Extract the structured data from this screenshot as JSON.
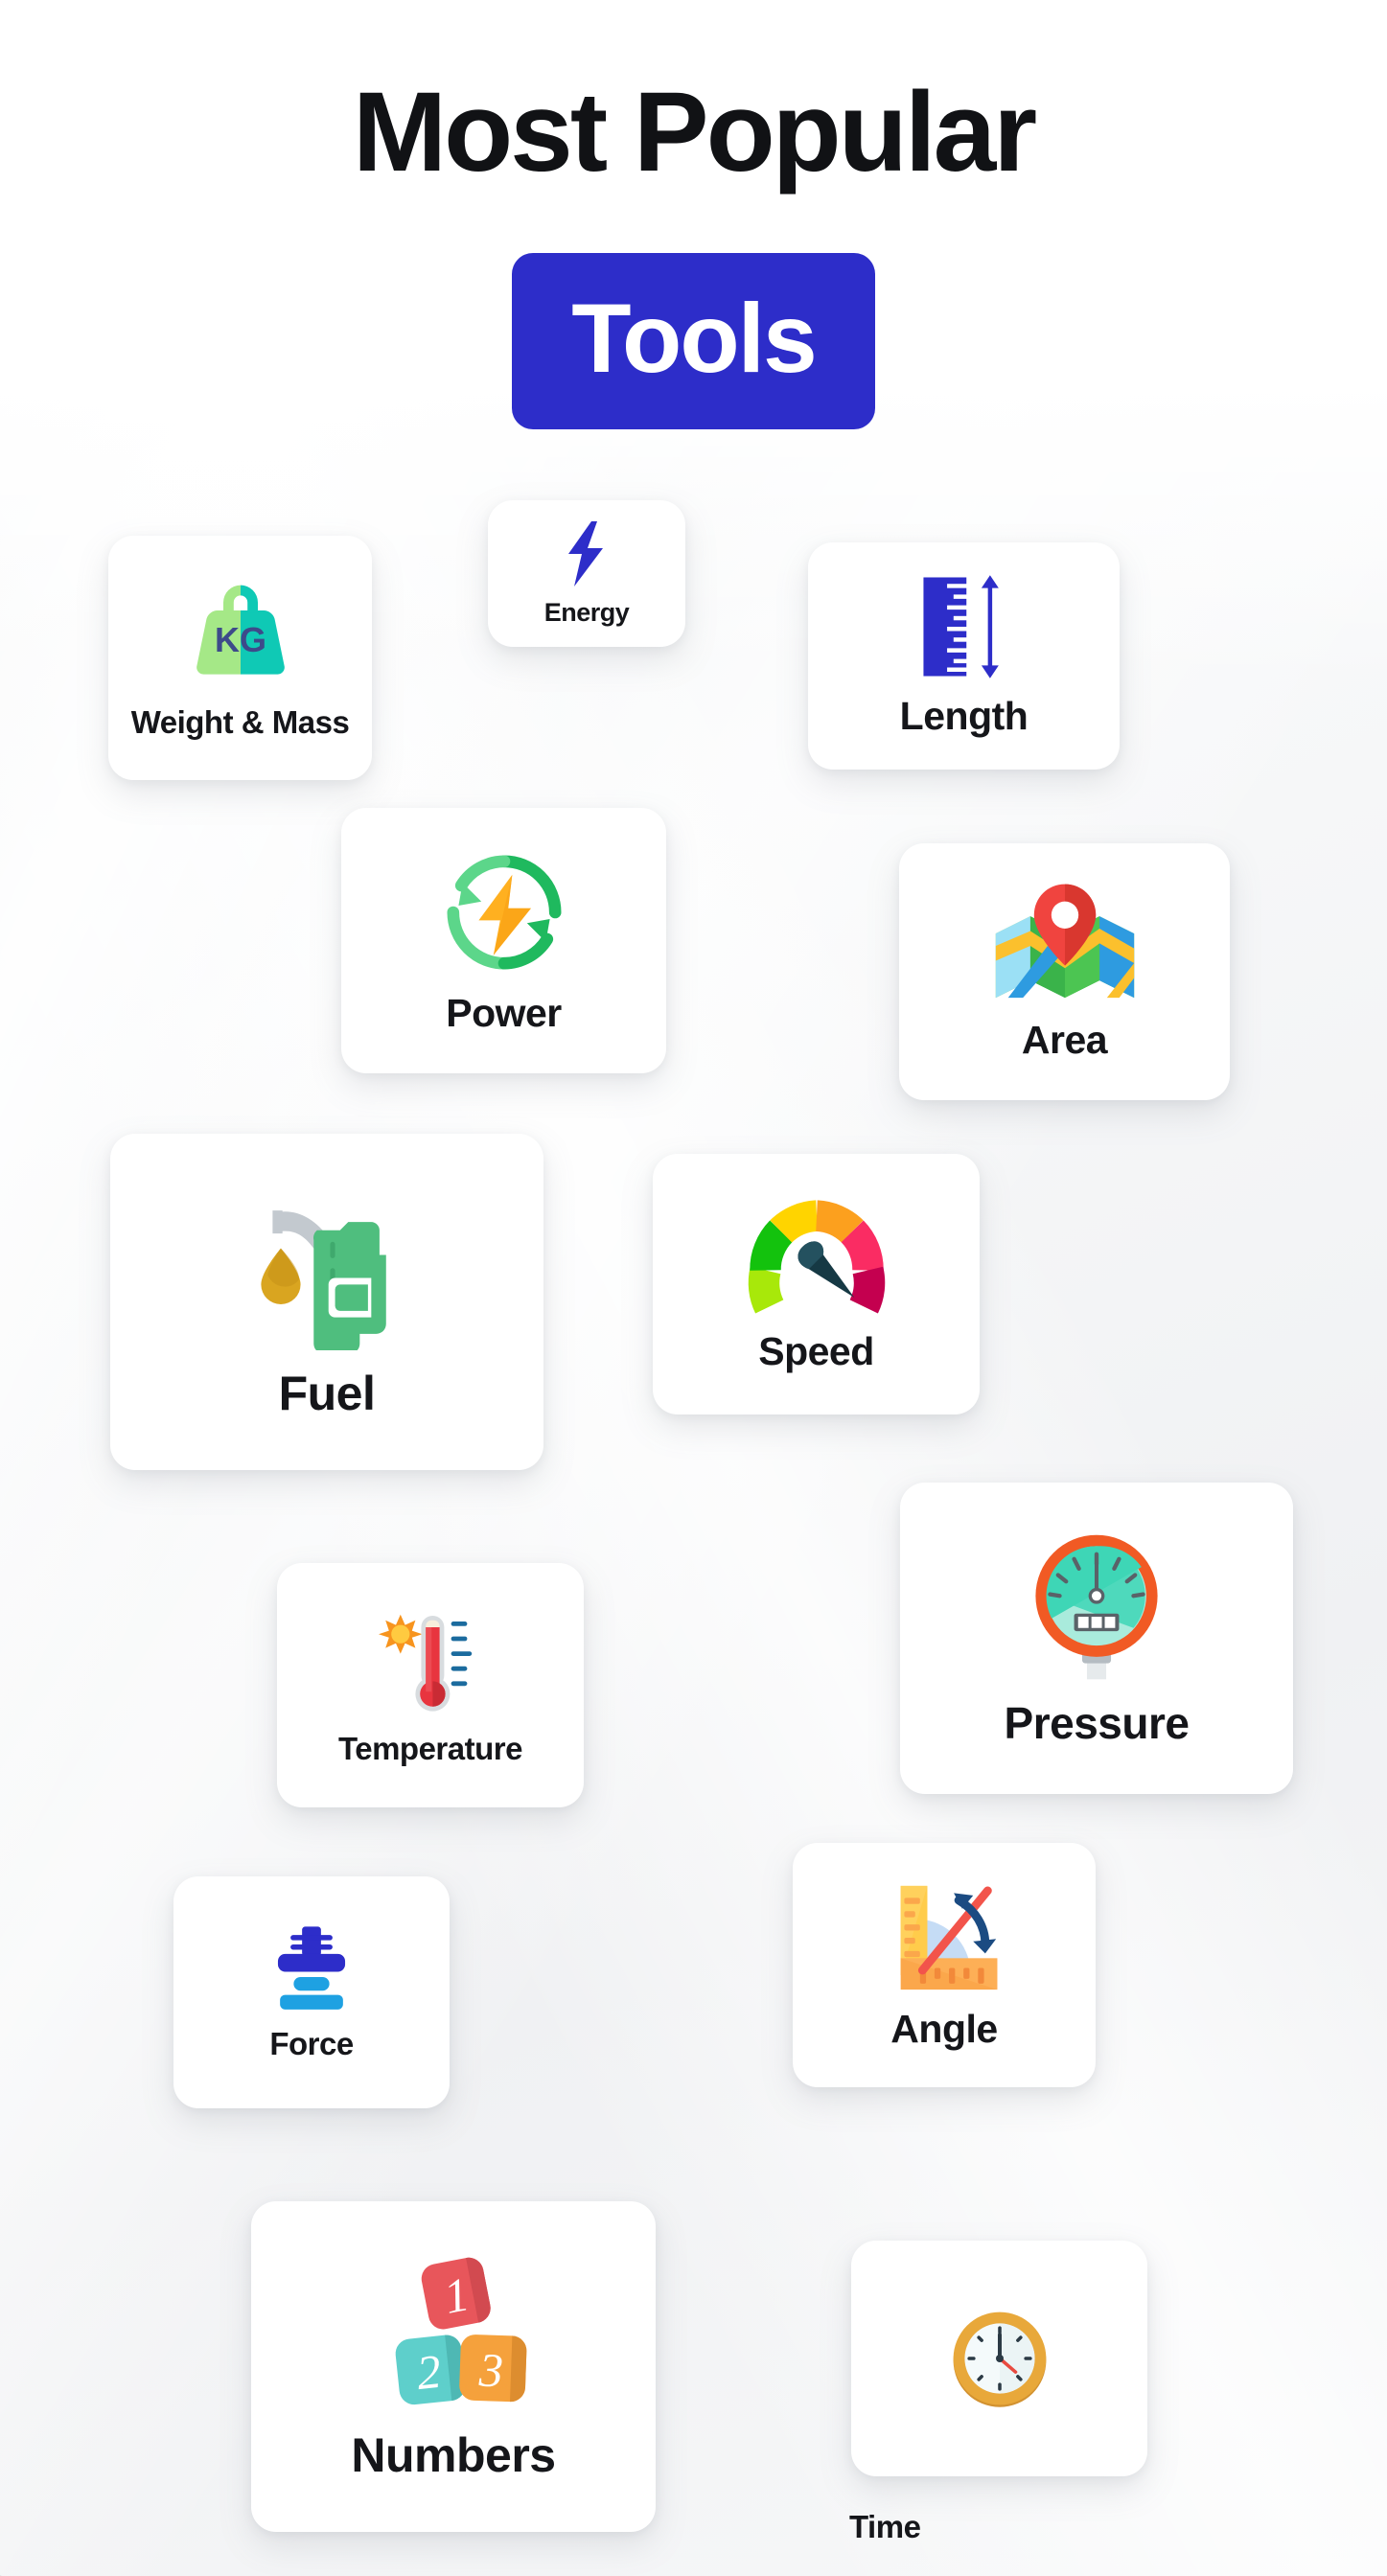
{
  "page": {
    "title_line1": "Most Popular",
    "badge_text": "Tools",
    "badge_color": "#2D2DC9",
    "background_color": "#f2f3f4",
    "card_color": "#ffffff",
    "text_color": "#15161a"
  },
  "cards": [
    {
      "id": "weight",
      "label": "Weight & Mass",
      "icon": "kg-weight-icon",
      "icon_colors": [
        "#A5E887",
        "#0FC9B5",
        "#3D4A8A"
      ]
    },
    {
      "id": "energy",
      "label": "Energy",
      "icon": "lightning-bolt-icon",
      "icon_colors": [
        "#2D2DC9"
      ]
    },
    {
      "id": "length",
      "label": "Length",
      "icon": "ruler-arrow-icon",
      "icon_colors": [
        "#2D2DC9"
      ]
    },
    {
      "id": "power",
      "label": "Power",
      "icon": "power-refresh-icon",
      "icon_colors": [
        "#3ACB6E",
        "#1FB95E",
        "#FFB020",
        "#F79E12"
      ]
    },
    {
      "id": "area",
      "label": "Area",
      "icon": "map-pin-icon",
      "icon_colors": [
        "#F0443F",
        "#4CC552",
        "#2E9BE0",
        "#FBC02D",
        "#9BE0F5"
      ]
    },
    {
      "id": "fuel",
      "label": "Fuel",
      "icon": "fuel-nozzle-icon",
      "icon_colors": [
        "#4FBE7E",
        "#C3C9CF",
        "#D9A520"
      ]
    },
    {
      "id": "speed",
      "label": "Speed",
      "icon": "speedometer-icon",
      "icon_colors": [
        "#A8E80A",
        "#13C20D",
        "#FFD400",
        "#FCA01E",
        "#FA2C63",
        "#C4004F",
        "#163944"
      ]
    },
    {
      "id": "pressure",
      "label": "Pressure",
      "icon": "pressure-gauge-icon",
      "icon_colors": [
        "#F15A24",
        "#3ED6B6",
        "#A9EBDC",
        "#5A6268"
      ]
    },
    {
      "id": "temperature",
      "label": "Temperature",
      "icon": "thermometer-icon",
      "icon_colors": [
        "#E8353F",
        "#D8DCDF",
        "#F7941E",
        "#1B6B9E"
      ]
    },
    {
      "id": "force",
      "label": "Force",
      "icon": "force-press-icon",
      "icon_colors": [
        "#2D2DC9",
        "#1EA1E2"
      ]
    },
    {
      "id": "angle",
      "label": "Angle",
      "icon": "angle-ruler-icon",
      "icon_colors": [
        "#FFD15C",
        "#FBA74B",
        "#F2544B",
        "#1B4B82",
        "#C5DCF5"
      ]
    },
    {
      "id": "numbers",
      "label": "Numbers",
      "icon": "number-blocks-icon",
      "icon_colors": [
        "#E8565B",
        "#5ECFCB",
        "#F5A13C"
      ],
      "values": [
        "1",
        "2",
        "3"
      ]
    },
    {
      "id": "time",
      "label": "Time",
      "icon": "clock-icon",
      "icon_colors": [
        "#E8A83A",
        "#F4FAFB",
        "#2B3A45",
        "#E84A3F"
      ]
    }
  ]
}
